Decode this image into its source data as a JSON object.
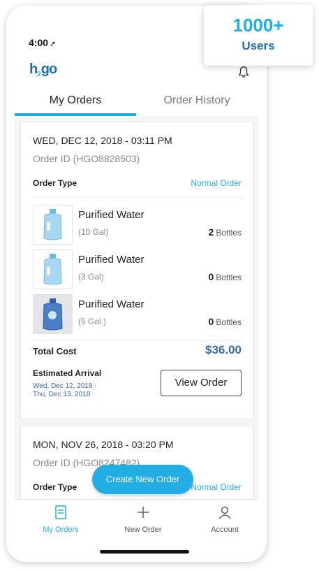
{
  "status": {
    "time": "4:00",
    "location_icon": "location-arrow-icon"
  },
  "app": {
    "logo_h": "h",
    "logo_2": "2",
    "logo_go": "go"
  },
  "tabs": [
    {
      "label": "My Orders",
      "active": true
    },
    {
      "label": "Order History",
      "active": false
    }
  ],
  "orders": [
    {
      "date": "WED, DEC 12, 2018 - 03:11 PM",
      "order_id": "Order ID (HGO8828503)",
      "order_type_label": "Order Type",
      "order_type": "Normal Order",
      "items": [
        {
          "name": "Purified Water",
          "size": "(10 Gal)",
          "qty": "2",
          "unit": "Bottles"
        },
        {
          "name": "Purified Water",
          "size": "(3 Gal)",
          "qty": "0",
          "unit": "Bottles"
        },
        {
          "name": "Purified Water",
          "size": "(5 Gal.)",
          "qty": "0",
          "unit": "Bottles"
        }
      ],
      "total_label": "Total Cost",
      "total": "$36.00",
      "eta_label": "Estimated Arrival",
      "eta_line1": "Wed, Dec 12, 2018 -",
      "eta_line2": "Thu, Dec 13, 2018",
      "view_button": "View Order"
    },
    {
      "date": "MON, NOV 26, 2018 - 03:20 PM",
      "order_id": "Order ID (HGO8247482)",
      "order_type_label": "Order Type",
      "order_type": "Normal Order"
    }
  ],
  "fab": {
    "label": "Create New Order"
  },
  "bottom_nav": [
    {
      "label": "My Orders",
      "icon": "orders-icon",
      "active": true
    },
    {
      "label": "New Order",
      "icon": "plus-icon",
      "active": false
    },
    {
      "label": "Account",
      "icon": "user-icon",
      "active": false
    }
  ],
  "badge": {
    "count": "1000+",
    "label": "Users"
  },
  "colors": {
    "accent": "#22aee4",
    "brand_blue": "#1f6fb3",
    "price": "#3a6aa8"
  }
}
